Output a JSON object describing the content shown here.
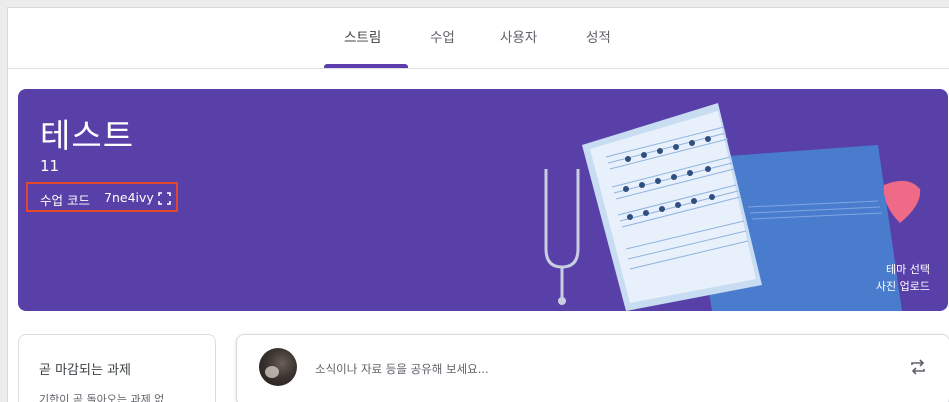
{
  "tabs": [
    {
      "label": "스트림",
      "active": true
    },
    {
      "label": "수업",
      "active": false
    },
    {
      "label": "사용자",
      "active": false
    },
    {
      "label": "성적",
      "active": false
    }
  ],
  "banner": {
    "title": "테스트",
    "section": "11",
    "class_code_label": "수업 코드",
    "class_code": "7ne4ivy",
    "select_theme": "테마 선택",
    "upload_photo": "사진 업로드",
    "background_color": "#5840a8",
    "highlight_color": "#e5472d"
  },
  "due_card": {
    "title": "곧 마감되는 과제",
    "body": "기한이 곧 돌아오는 과제 없"
  },
  "share": {
    "placeholder": "소식이나 자료 등을 공유해 보세요..."
  },
  "icons": {
    "expand": "fullscreen-icon",
    "repost": "repeat-icon"
  }
}
